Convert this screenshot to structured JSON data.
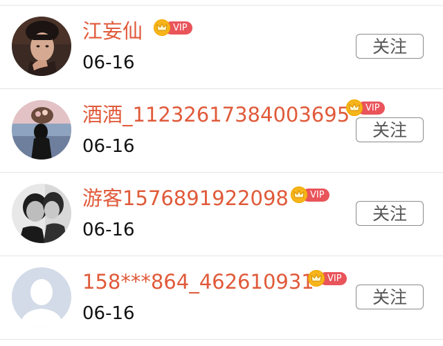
{
  "users": [
    {
      "name": "江妄仙",
      "date": "06-16",
      "vip_label": "VIP",
      "follow_label": "关注",
      "avatar": "avatar-young-man-hand-on-chin"
    },
    {
      "name": "酒酒_11232617384003695",
      "date": "06-16",
      "vip_label": "VIP",
      "follow_label": "关注",
      "avatar": "avatar-girl-with-flowers-at-sea"
    },
    {
      "name": "游客1576891922098",
      "date": "06-16",
      "vip_label": "VIP",
      "follow_label": "关注",
      "avatar": "avatar-two-men-bw"
    },
    {
      "name": "158***864_462610931",
      "date": "06-16",
      "vip_label": "VIP",
      "follow_label": "关注",
      "avatar": "avatar-default-person"
    }
  ],
  "colors": {
    "name": "#e05a3a",
    "vip_badge": "#e9545a",
    "crown": "#f6b51a",
    "date": "#111111",
    "divider": "#e5e5e5"
  }
}
